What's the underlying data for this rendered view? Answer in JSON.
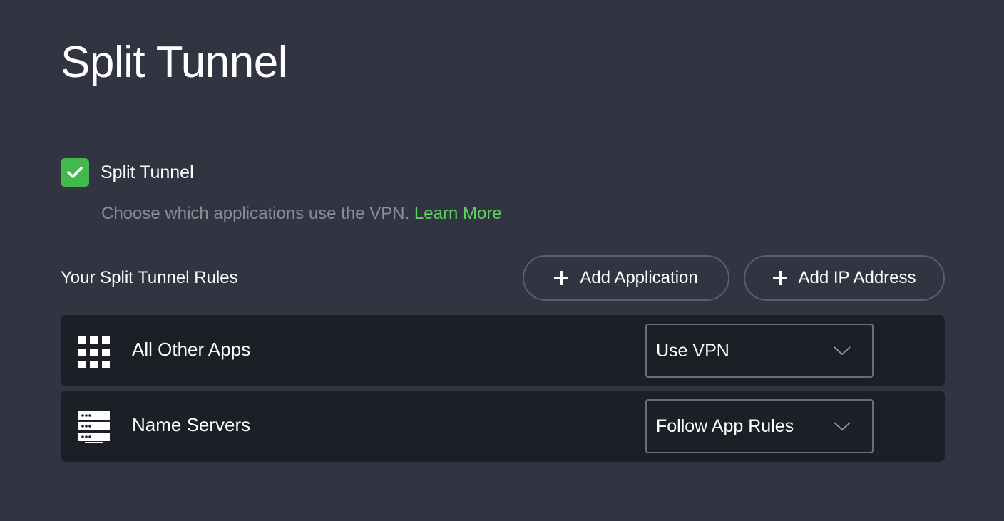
{
  "page": {
    "title": "Split Tunnel"
  },
  "toggle": {
    "label": "Split Tunnel",
    "checked": true,
    "check_color": "#43b94d"
  },
  "description": {
    "text": "Choose which applications use the VPN.",
    "link_label": "Learn More",
    "link_color": "#5ed05f"
  },
  "rules": {
    "header": "Your Split Tunnel Rules",
    "add_application_label": "Add Application",
    "add_ip_label": "Add IP Address",
    "items": [
      {
        "icon": "grid-icon",
        "label": "All Other Apps",
        "selection": "Use VPN"
      },
      {
        "icon": "server-icon",
        "label": "Name Servers",
        "selection": "Follow App Rules"
      }
    ]
  },
  "colors": {
    "background": "#323541",
    "row_background": "#1d1f27",
    "accent_green": "#43b94d"
  }
}
